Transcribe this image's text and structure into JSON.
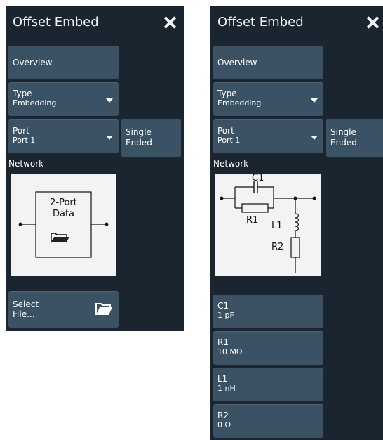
{
  "left_panel": {
    "title": "Offset Embed",
    "overview": "Overview",
    "type_label": "Type",
    "type_value": "Embedding",
    "port_label": "Port",
    "port_value": "Port 1",
    "side_line1": "Single",
    "side_line2": "Ended",
    "network_label": "Network",
    "diagram_line1": "2-Port",
    "diagram_line2": "Data",
    "select_line1": "Select",
    "select_line2": "File..."
  },
  "right_panel": {
    "title": "Offset Embed",
    "overview": "Overview",
    "type_label": "Type",
    "type_value": "Embedding",
    "port_label": "Port",
    "port_value": "Port 1",
    "side_line1": "Single",
    "side_line2": "Ended",
    "network_label": "Network",
    "circuit_labels": {
      "c1": "C1",
      "r1": "R1",
      "l1": "L1",
      "r2": "R2"
    },
    "params": [
      {
        "name": "C1",
        "value": "1 pF"
      },
      {
        "name": "R1",
        "value": "10 MΩ"
      },
      {
        "name": "L1",
        "value": "1 nH"
      },
      {
        "name": "R2",
        "value": "0 Ω"
      }
    ]
  },
  "colors": {
    "panel_bg": "#1b2530",
    "button_bg": "#3b5264",
    "diagram_bg": "#f2f3f4",
    "text": "#ffffff"
  },
  "icons": [
    "close-icon",
    "dropdown-arrow-icon",
    "folder-open-icon"
  ]
}
